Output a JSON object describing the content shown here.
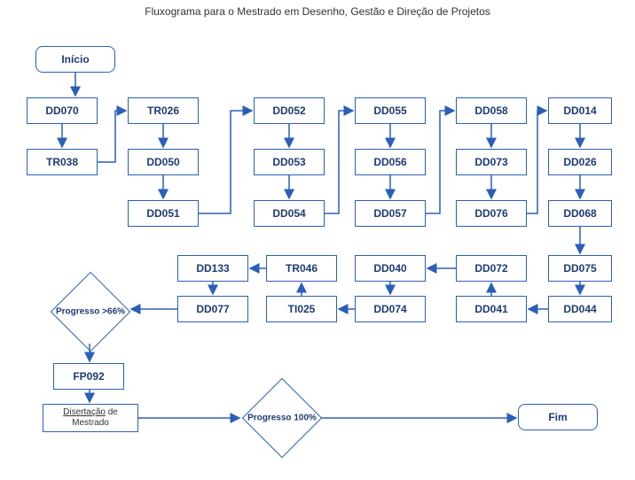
{
  "title": "Fluxograma para o Mestrado em Desenho, Gestão e Direção de Projetos",
  "nodes": {
    "start": "Início",
    "dd070": "DD070",
    "tr038": "TR038",
    "tr026": "TR026",
    "dd050": "DD050",
    "dd051": "DD051",
    "dd052": "DD052",
    "dd053": "DD053",
    "dd054": "DD054",
    "dd055": "DD055",
    "dd056": "DD056",
    "dd057": "DD057",
    "dd058": "DD058",
    "dd073": "DD073",
    "dd076": "DD076",
    "dd014": "DD014",
    "dd026": "DD026",
    "dd068": "DD068",
    "dd075": "DD075",
    "dd044": "DD044",
    "dd072": "DD072",
    "dd041": "DD041",
    "dd040": "DD040",
    "dd074": "DD074",
    "tr046": "TR046",
    "ti025": "TI025",
    "dd133": "DD133",
    "dd077": "DD077",
    "progress66": "Progresso >66%",
    "fp092": "FP092",
    "diss_word": "Disertação",
    "diss_tail": " de Mestrado",
    "progress100": "Progresso 100%",
    "end": "Fim"
  }
}
